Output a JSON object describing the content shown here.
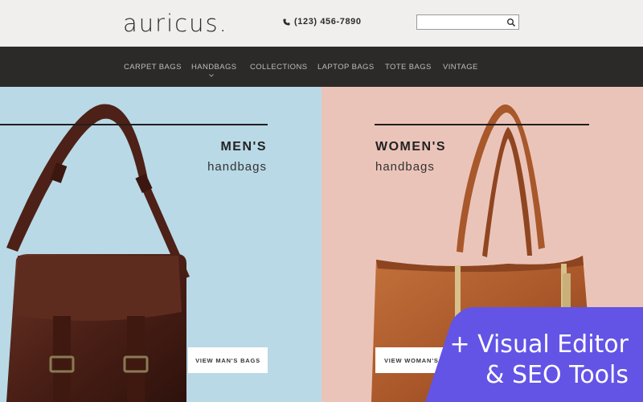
{
  "header": {
    "logo": "auricus.",
    "phone": "(123) 456-7890",
    "search": {
      "placeholder": "",
      "value": ""
    }
  },
  "nav": {
    "items": [
      {
        "label": "CARPET BAGS"
      },
      {
        "label": "HANDBAGS"
      },
      {
        "label": "COLLECTIONS"
      },
      {
        "label": "LAPTOP BAGS"
      },
      {
        "label": "TOTE BAGS"
      },
      {
        "label": "VINTAGE"
      }
    ]
  },
  "panels": {
    "men": {
      "title": "MEN'S",
      "subtitle": "handbags",
      "cta": "VIEW MAN'S BAGS",
      "bg": "#b9d9e6"
    },
    "women": {
      "title": "WOMEN'S",
      "subtitle": "handbags",
      "cta": "VIEW WOMAN'S BAGS",
      "bg": "#ebc4b9"
    }
  },
  "promo": {
    "line1": "+ Visual Editor",
    "line2": "& SEO Tools",
    "color": "#6354e6"
  },
  "colors": {
    "topbar": "#f0efed",
    "nav": "#2b2a28",
    "bag_brown": "#5a2a1e",
    "bag_tan": "#b5642f"
  },
  "icons": {
    "phone": "phone-icon",
    "search": "search-icon",
    "chevron": "chevron-down-icon"
  }
}
